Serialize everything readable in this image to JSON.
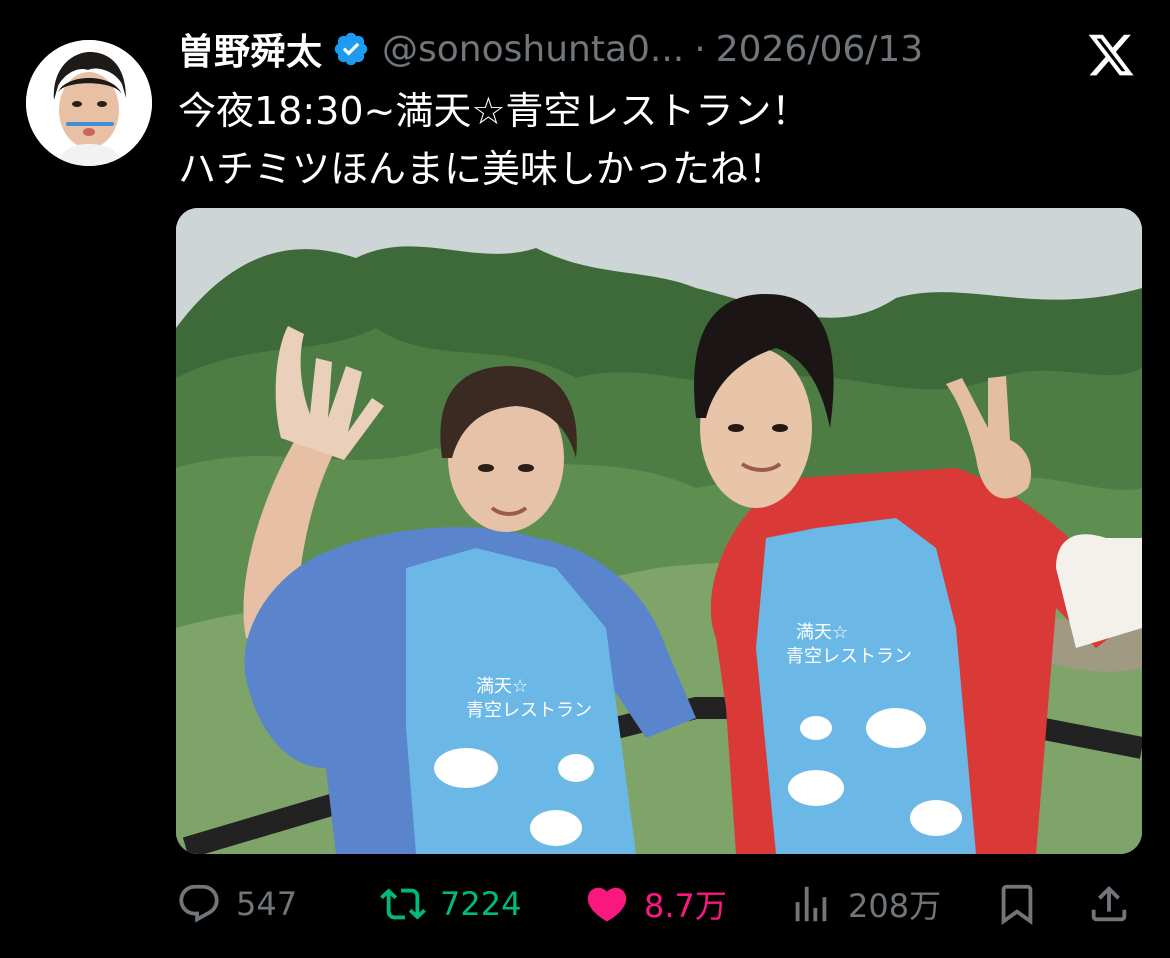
{
  "author": {
    "name": "曽野舜太",
    "handle": "@sonoshunta0...",
    "separator": "·",
    "date": "2026/06/13"
  },
  "tweet": {
    "lines": [
      "今夜18:30~満天☆青空レストラン！",
      "ハチミツほんまに美味しかったね！"
    ]
  },
  "media": {
    "apron_text_line1": "満天☆",
    "apron_text_line2": "青空レストラン"
  },
  "actions": {
    "replies": "547",
    "reposts": "7224",
    "likes": "8.7万",
    "views": "208万"
  },
  "colors": {
    "background": "#000000",
    "verified": "#1d9bf0",
    "muted": "#71767b",
    "repost": "#00ba7c",
    "like": "#f91880"
  },
  "icons": [
    "x-logo-icon",
    "verified-badge-icon",
    "reply-icon",
    "repost-icon",
    "like-icon",
    "views-icon",
    "bookmark-icon",
    "share-icon"
  ]
}
